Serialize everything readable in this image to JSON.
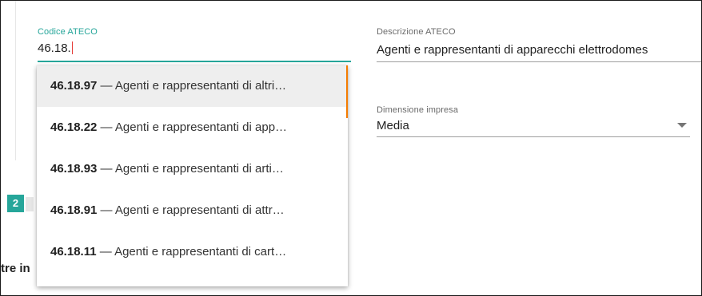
{
  "ateco_field": {
    "label": "Codice ATECO",
    "value": "46.18."
  },
  "description_field": {
    "label": "Descrizione ATECO",
    "value": "Agenti e rappresentanti di apparecchi elettrodomes"
  },
  "size_field": {
    "label": "Dimensione impresa",
    "value": "Media"
  },
  "step_badge": "2",
  "partial_heading": "tre in",
  "autocomplete": {
    "items": [
      {
        "code": "46.18.97",
        "text": " — Agenti e rappresentanti di altri…"
      },
      {
        "code": "46.18.22",
        "text": " — Agenti e rappresentanti di app…"
      },
      {
        "code": "46.18.93",
        "text": " — Agenti e rappresentanti di arti…"
      },
      {
        "code": "46.18.91",
        "text": " — Agenti e rappresentanti di attr…"
      },
      {
        "code": "46.18.11",
        "text": " — Agenti e rappresentanti di cart…"
      }
    ]
  },
  "colors": {
    "accent": "#26a69a",
    "scrollbar": "#f57c00"
  }
}
